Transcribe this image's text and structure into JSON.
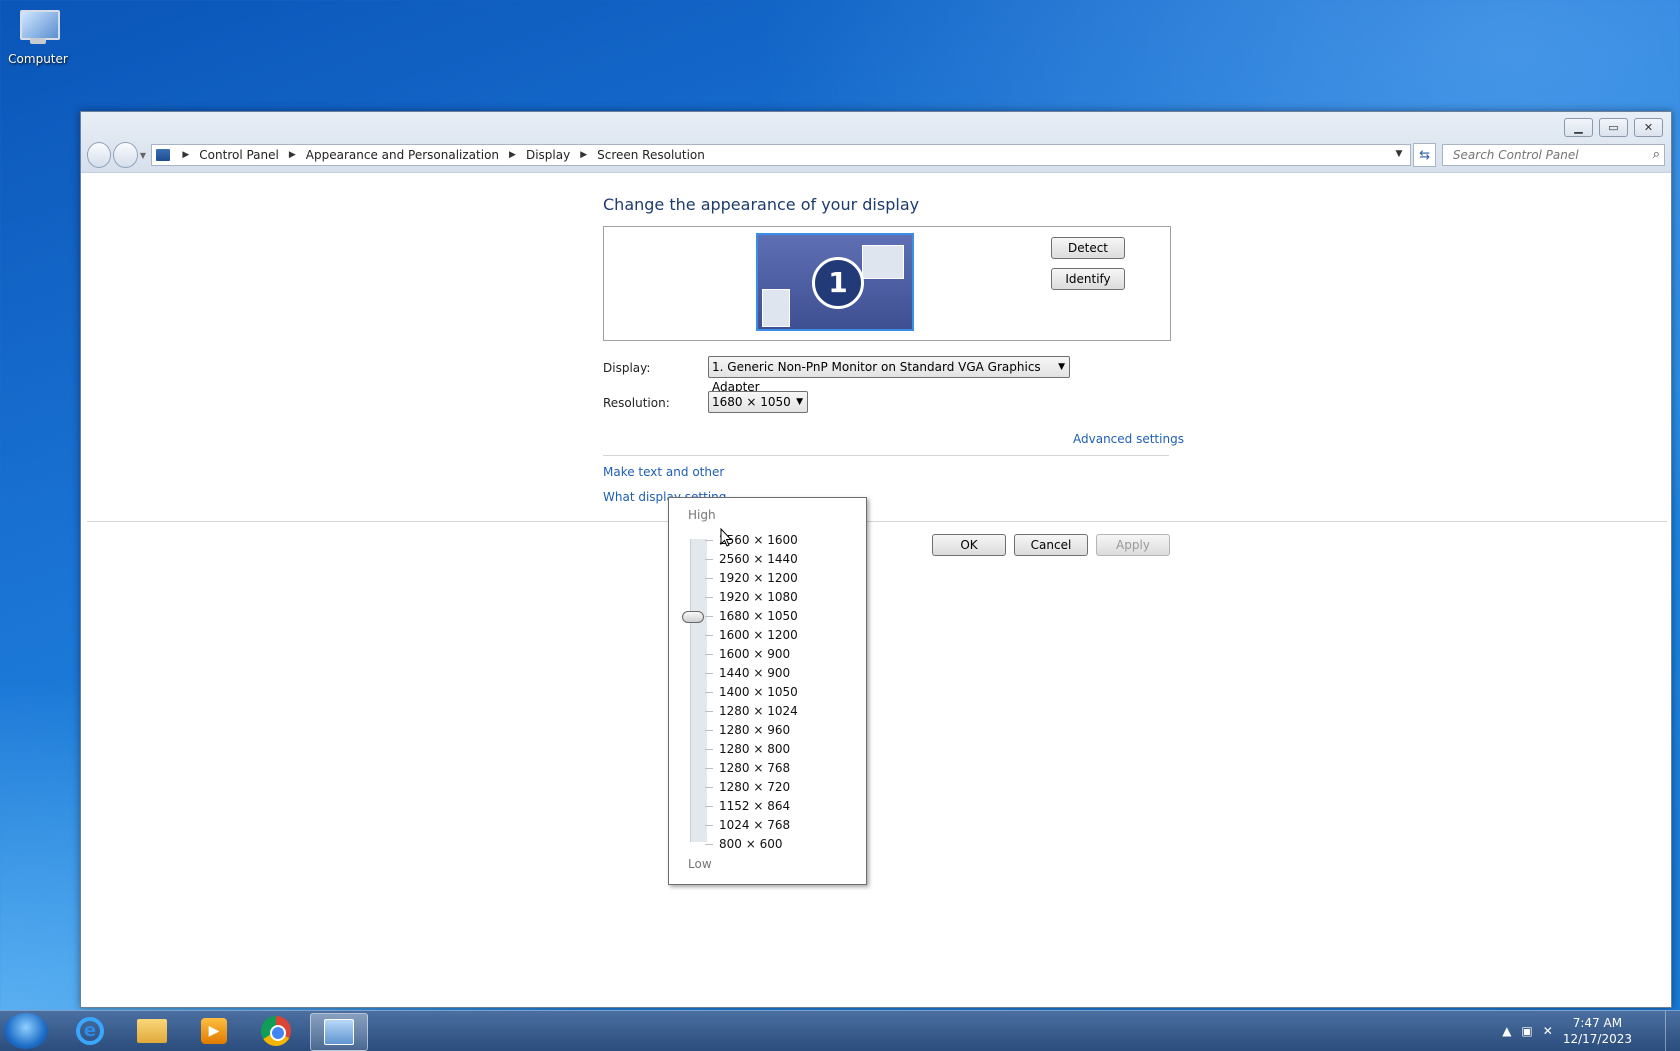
{
  "desktop": {
    "computer_label": "Computer"
  },
  "breadcrumb": [
    "Control Panel",
    "Appearance and Personalization",
    "Display",
    "Screen Resolution"
  ],
  "search": {
    "placeholder": "Search Control Panel"
  },
  "page": {
    "title": "Change the appearance of your display",
    "monitor_number": "1",
    "detect_label": "Detect",
    "identify_label": "Identify",
    "display_label": "Display:",
    "display_value": "1. Generic Non-PnP Monitor on Standard VGA Graphics Adapter",
    "resolution_label": "Resolution:",
    "resolution_value": "1680 × 1050",
    "advanced_link": "Advanced settings",
    "text_link": "Make text and other",
    "settings_link": "What display setting",
    "ok_label": "OK",
    "cancel_label": "Cancel",
    "apply_label": "Apply"
  },
  "resolution_dropdown": {
    "high_label": "High",
    "low_label": "Low",
    "selected": "1680 × 1050",
    "options": [
      "2560 × 1600",
      "2560 × 1440",
      "1920 × 1200",
      "1920 × 1080",
      "1680 × 1050",
      "1600 × 1200",
      "1600 × 900",
      "1440 × 900",
      "1400 × 1050",
      "1280 × 1024",
      "1280 × 960",
      "1280 × 800",
      "1280 × 768",
      "1280 × 720",
      "1152 × 864",
      "1024 × 768",
      "800 × 600"
    ]
  },
  "taskbar": {
    "items": [
      "start-button",
      "internet-explorer",
      "file-explorer",
      "media-player",
      "chrome",
      "control-panel"
    ],
    "time": "7:47 AM",
    "date": "12/17/2023"
  }
}
